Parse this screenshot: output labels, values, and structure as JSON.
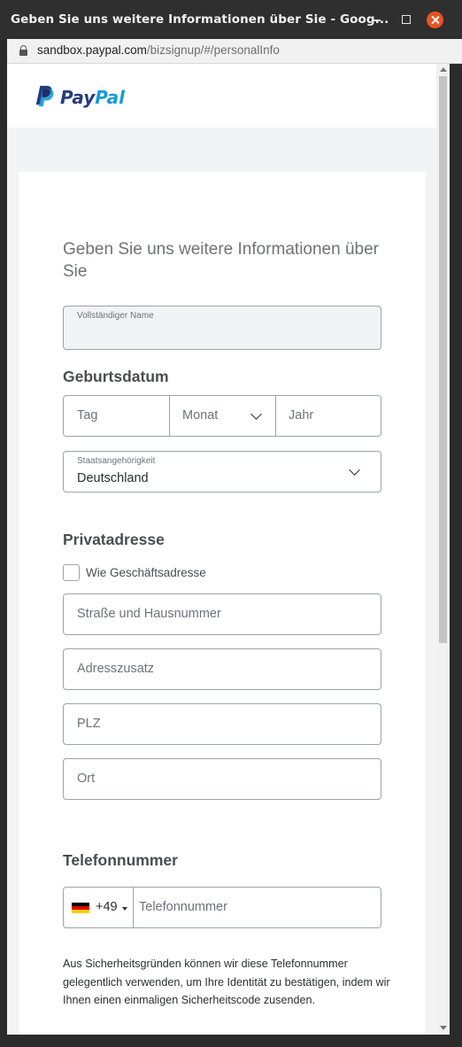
{
  "window": {
    "title": "Geben Sie uns weitere Informationen über Sie - Goog..."
  },
  "address_bar": {
    "domain": "sandbox.paypal.com",
    "path": "/bizsignup/#/personalInfo"
  },
  "brand": {
    "name_part1": "Pay",
    "name_part2": "Pal",
    "colors": {
      "dark_blue": "#253b80",
      "light_blue": "#179bd7"
    }
  },
  "form": {
    "heading": "Geben Sie uns weitere Informationen über Sie",
    "full_name_label": "Vollständiger Name",
    "dob": {
      "section_title": "Geburtsdatum",
      "day_placeholder": "Tag",
      "month_placeholder": "Monat",
      "year_placeholder": "Jahr"
    },
    "nationality": {
      "label": "Staatsangehörigkeit",
      "value": "Deutschland"
    },
    "address": {
      "section_title": "Privatadresse",
      "same_as_business_label": "Wie Geschäftsadresse",
      "same_as_business_checked": false,
      "street_placeholder": "Straße und Hausnummer",
      "addition_placeholder": "Adresszusatz",
      "zip_placeholder": "PLZ",
      "city_placeholder": "Ort"
    },
    "phone": {
      "section_title": "Telefonnummer",
      "country_flag": "germany-flag",
      "country_code": "+49",
      "placeholder": "Telefonnummer",
      "note": "Aus Sicherheitsgründen können wir diese Telefonnummer gelegentlich verwenden, um Ihre Identität zu bestätigen, indem wir Ihnen einen einmaligen Sicherheitscode zusenden."
    }
  }
}
